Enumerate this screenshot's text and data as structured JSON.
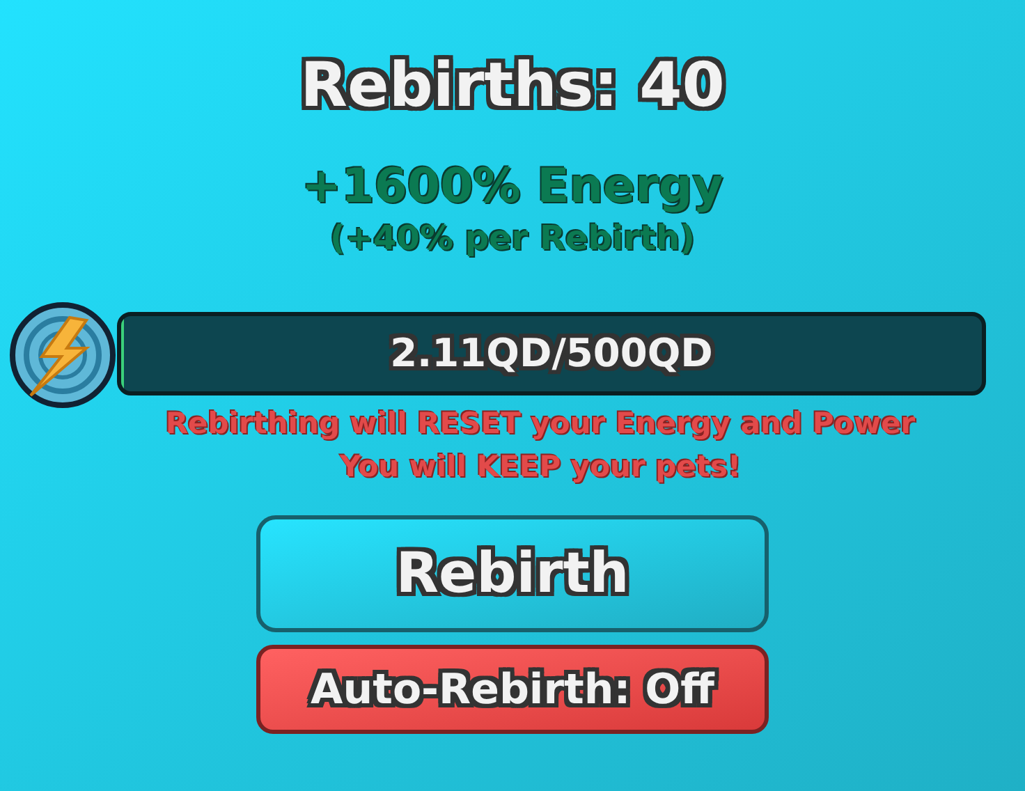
{
  "title": "Rebirths: 40",
  "bonus": "+1600% Energy",
  "bonus_note": "(+40% per Rebirth)",
  "progress": {
    "label": "2.11QD/500QD",
    "level": 0.004
  },
  "warnings": [
    "Rebirthing will RESET your Energy and Power",
    "You will KEEP your pets!"
  ],
  "rebirth_button": "Rebirth",
  "auto_button": {
    "label": "Auto-Rebirth: Off",
    "on": false
  }
}
